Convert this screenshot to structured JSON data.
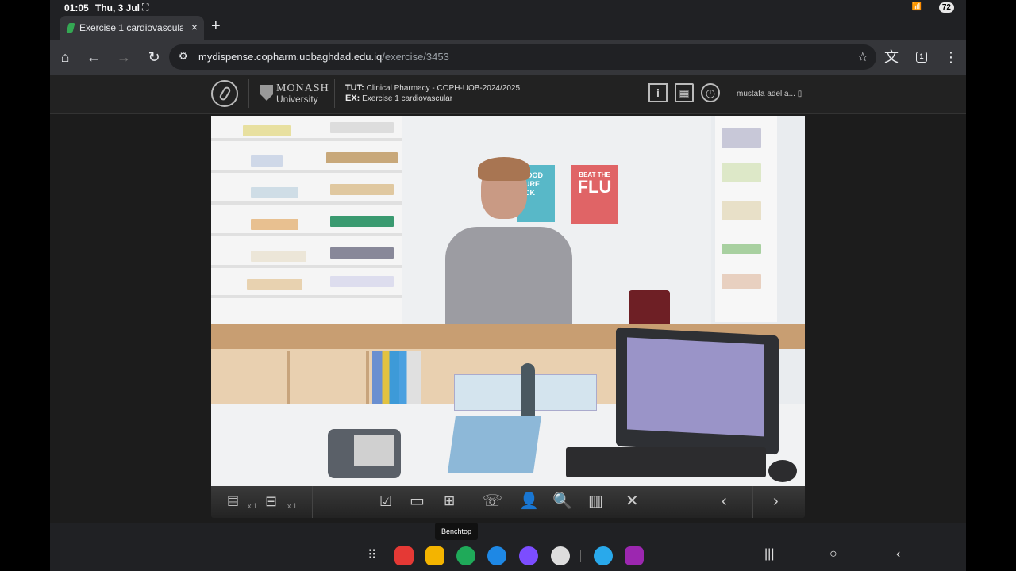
{
  "status_bar": {
    "time": "01:05",
    "date": "Thu, 3 Jul",
    "battery": "72",
    "signal": "wifi"
  },
  "browser": {
    "tab_title": "Exercise 1 cardiovascular -",
    "tab_close": "×",
    "new_tab": "+",
    "url_domain": "mydispense.copharm.uobaghdad.edu.iq",
    "url_path": "/exercise/3453",
    "tab_count": "1"
  },
  "app_header": {
    "university_line1": "MONASH",
    "university_line2": "University",
    "tut_label": "TUT:",
    "tut_value": "Clinical Pharmacy - COPH-UOB-2024/2025",
    "ex_label": "EX:",
    "ex_value": "Exercise 1 cardiovascular",
    "info_icon": "i",
    "user_name": "mustafa adel a... ▯"
  },
  "scene": {
    "poster1_text": "E OOD SURE ECK",
    "poster2_top": "BEAT THE",
    "poster2_main": "FLU"
  },
  "controls": {
    "count1": "x 1",
    "count2": "x 1",
    "tooltip": "Benchtop"
  },
  "colors": {
    "accent": "#8ab4f8",
    "scene_bg": "#e9ecef",
    "page_bg": "#1c1c1c"
  }
}
